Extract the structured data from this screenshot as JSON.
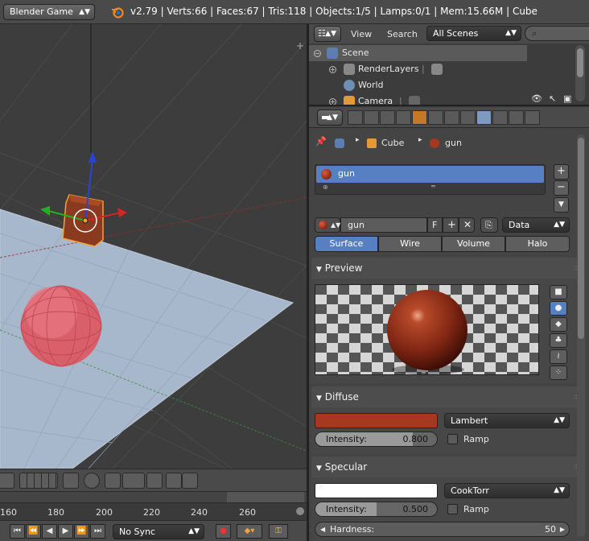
{
  "topbar": {
    "engine": "Blender Game",
    "stats": "v2.79 | Verts:66 | Faces:67 | Tris:118 | Objects:1/5 | Lamps:0/1 | Mem:15.66M | Cube"
  },
  "timeline": {
    "ticks": [
      "160",
      "180",
      "200",
      "220",
      "240",
      "260"
    ],
    "sync": "No Sync"
  },
  "outliner": {
    "view_menu": "View",
    "search_menu": "Search",
    "display_mode": "All Scenes",
    "rows": [
      {
        "label": "Scene",
        "icon": "scene-icon"
      },
      {
        "label": "RenderLayers",
        "icon": "render-layers-icon"
      },
      {
        "label": "World",
        "icon": "world-icon"
      },
      {
        "label": "Camera",
        "icon": "camera-icon"
      }
    ]
  },
  "properties": {
    "breadcrumb": {
      "object": "Cube",
      "material": "gun"
    },
    "material_slot": "gun",
    "material_name": "gun",
    "fake_user": "F",
    "link": "Data",
    "tabs": [
      "Surface",
      "Wire",
      "Volume",
      "Halo"
    ],
    "active_tab": "Surface",
    "preview": {
      "title": "Preview"
    },
    "diffuse": {
      "title": "Diffuse",
      "color": "#a5381f",
      "shader": "Lambert",
      "intensity_label": "Intensity:",
      "intensity": "0.800",
      "intensity_value": 0.8,
      "ramp": "Ramp"
    },
    "specular": {
      "title": "Specular",
      "color": "#ffffff",
      "shader": "CookTorr",
      "intensity_label": "Intensity:",
      "intensity": "0.500",
      "intensity_value": 0.5,
      "ramp": "Ramp",
      "hardness_label": "Hardness:",
      "hardness": "50"
    }
  },
  "colors": {
    "selection": "#5680c2",
    "material_red": "#a5381f",
    "sphere_pink": "#d9606b",
    "ground_plane": "#a8b8cc"
  }
}
